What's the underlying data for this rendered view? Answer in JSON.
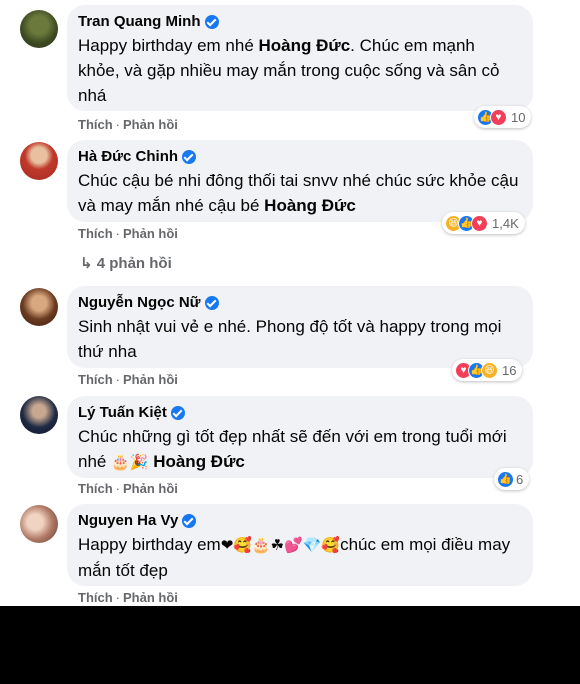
{
  "comments": [
    {
      "name": "Tran Quang Minh",
      "text_before": "Happy birthday em nhé ",
      "mention": "Hoàng Đức",
      "text_after": ". Chúc em mạnh khỏe, và gặp nhiều may mắn trong cuộc sống và sân cỏ nhá",
      "like": "Thích",
      "reply": "Phản hồi",
      "reaction_count": "10",
      "reactions": [
        "like-icon",
        "love-icon"
      ]
    },
    {
      "name": "Hà Đức Chinh",
      "text_before": "Chúc cậu bé nhi đông thối tai snvv nhé chúc sức khỏe cậu và may mắn nhé cậu bé ",
      "mention": "Hoàng Đức",
      "like": "Thích",
      "reply": "Phản hồi",
      "reaction_count": "1,4K",
      "reactions": [
        "haha-icon",
        "like-icon",
        "love-icon"
      ],
      "replies_label": "4 phản hồi"
    },
    {
      "name": "Nguyễn Ngọc Nữ",
      "text": "Sinh nhật vui vẻ e nhé. Phong độ tốt và happy trong mọi thứ nha",
      "like": "Thích",
      "reply": "Phản hồi",
      "reaction_count": "16",
      "reactions": [
        "love-icon",
        "like-icon",
        "haha-icon"
      ]
    },
    {
      "name": "Lý Tuấn Kiệt",
      "text_before": "Chúc những gì tốt đẹp nhất sẽ đến với em trong tuổi mới nhé ",
      "emojis": "🎂🎉",
      "mention": "Hoàng Đức",
      "like": "Thích",
      "reply": "Phản hồi",
      "reaction_count": "6",
      "reactions": [
        "like-icon"
      ]
    },
    {
      "name": "Nguyen Ha Vy",
      "text_before": "Happy birthday em",
      "emojis": "❤🥰🎂☘💕💎🥰",
      "text_after": "chúc em mọi điều may mắn tốt đẹp",
      "like": "Thích",
      "reply": "Phản hồi"
    }
  ],
  "colors": {
    "bubble": "#f0f2f5",
    "meta_text": "#65676b",
    "like_blue": "#1877f2",
    "love_red": "#f33e58",
    "haha_yellow": "#f7b125"
  }
}
